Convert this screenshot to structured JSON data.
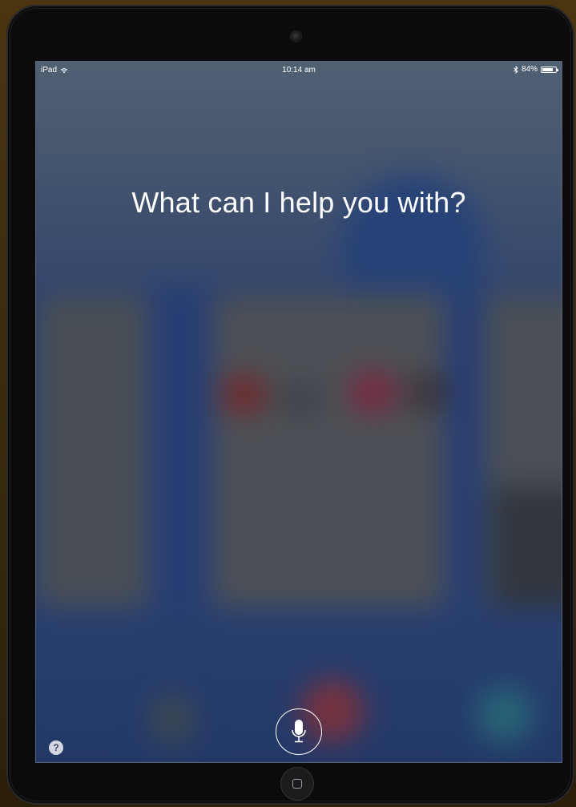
{
  "device": "iPad",
  "status_bar": {
    "carrier": "iPad",
    "wifi_icon": "wifi-icon",
    "time": "10:14 am",
    "bluetooth_icon": "bluetooth-icon",
    "battery_percent": "84%",
    "battery_level": 0.84
  },
  "siri": {
    "prompt": "What can I help you with?",
    "mic_icon": "microphone-icon",
    "help_label": "?"
  },
  "colors": {
    "text": "#ffffff",
    "bezel": "#0b0b0c"
  }
}
